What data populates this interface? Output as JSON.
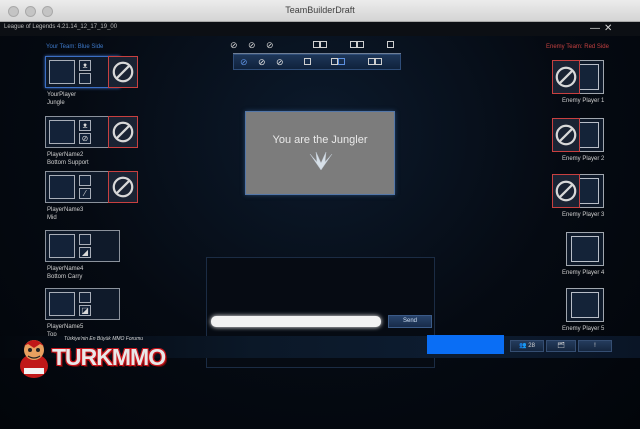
{
  "window": {
    "title": "TeamBuilderDraft"
  },
  "client": {
    "version": "League of Legends 4.21.14_12_17_19_00",
    "minimize": "—",
    "close": "✕"
  },
  "teams": {
    "blue_label": "Your Team: Blue Side",
    "red_label": "Enemy Team: Red Side"
  },
  "ally_players": [
    {
      "name": "YourPlayer",
      "role": "Jungle",
      "selected": true,
      "top_spell_icon": "smite-claw-icon",
      "bottom_spell_icon": "",
      "banned": true
    },
    {
      "name": "PlayerName2",
      "role": "Bottom Support",
      "selected": false,
      "top_spell_icon": "smite-claw-icon",
      "bottom_spell_icon": "flash-icon",
      "banned": true
    },
    {
      "name": "PlayerName3",
      "role": "Mid",
      "selected": false,
      "top_spell_icon": "",
      "bottom_spell_icon": "slash-icon",
      "banned": true
    },
    {
      "name": "PlayerName4",
      "role": "Bottom Carry",
      "selected": false,
      "top_spell_icon": "",
      "bottom_spell_icon": "corner-icon",
      "banned": false
    },
    {
      "name": "PlayerName5",
      "role": "Top",
      "selected": false,
      "top_spell_icon": "",
      "bottom_spell_icon": "teleport-icon",
      "banned": false
    }
  ],
  "enemy_players": [
    {
      "name": "Enemy Player 1",
      "banned": true
    },
    {
      "name": "Enemy Player 2",
      "banned": true
    },
    {
      "name": "Enemy Player 3",
      "banned": true
    },
    {
      "name": "Enemy Player 4",
      "banned": false
    },
    {
      "name": "Enemy Player 5",
      "banned": false
    }
  ],
  "jungler_panel": {
    "text": "You are the Jungler",
    "icon": "smite-claw-icon"
  },
  "chat": {
    "placeholder": "",
    "send_label": "Send"
  },
  "bottom": {
    "friends_count": "28",
    "friends_icon": "friends-icon",
    "folder_icon": "folder-icon",
    "alert_label": "!"
  },
  "branding": {
    "tagline": "Türkiye'nin En Büyük MMO Forumu",
    "wordmark": "TURKMMO"
  },
  "colors": {
    "blue_team": "#3d78c8",
    "red_team": "#c24040",
    "ban_red": "#c84040",
    "highlight_blue": "#0a6ef5"
  }
}
